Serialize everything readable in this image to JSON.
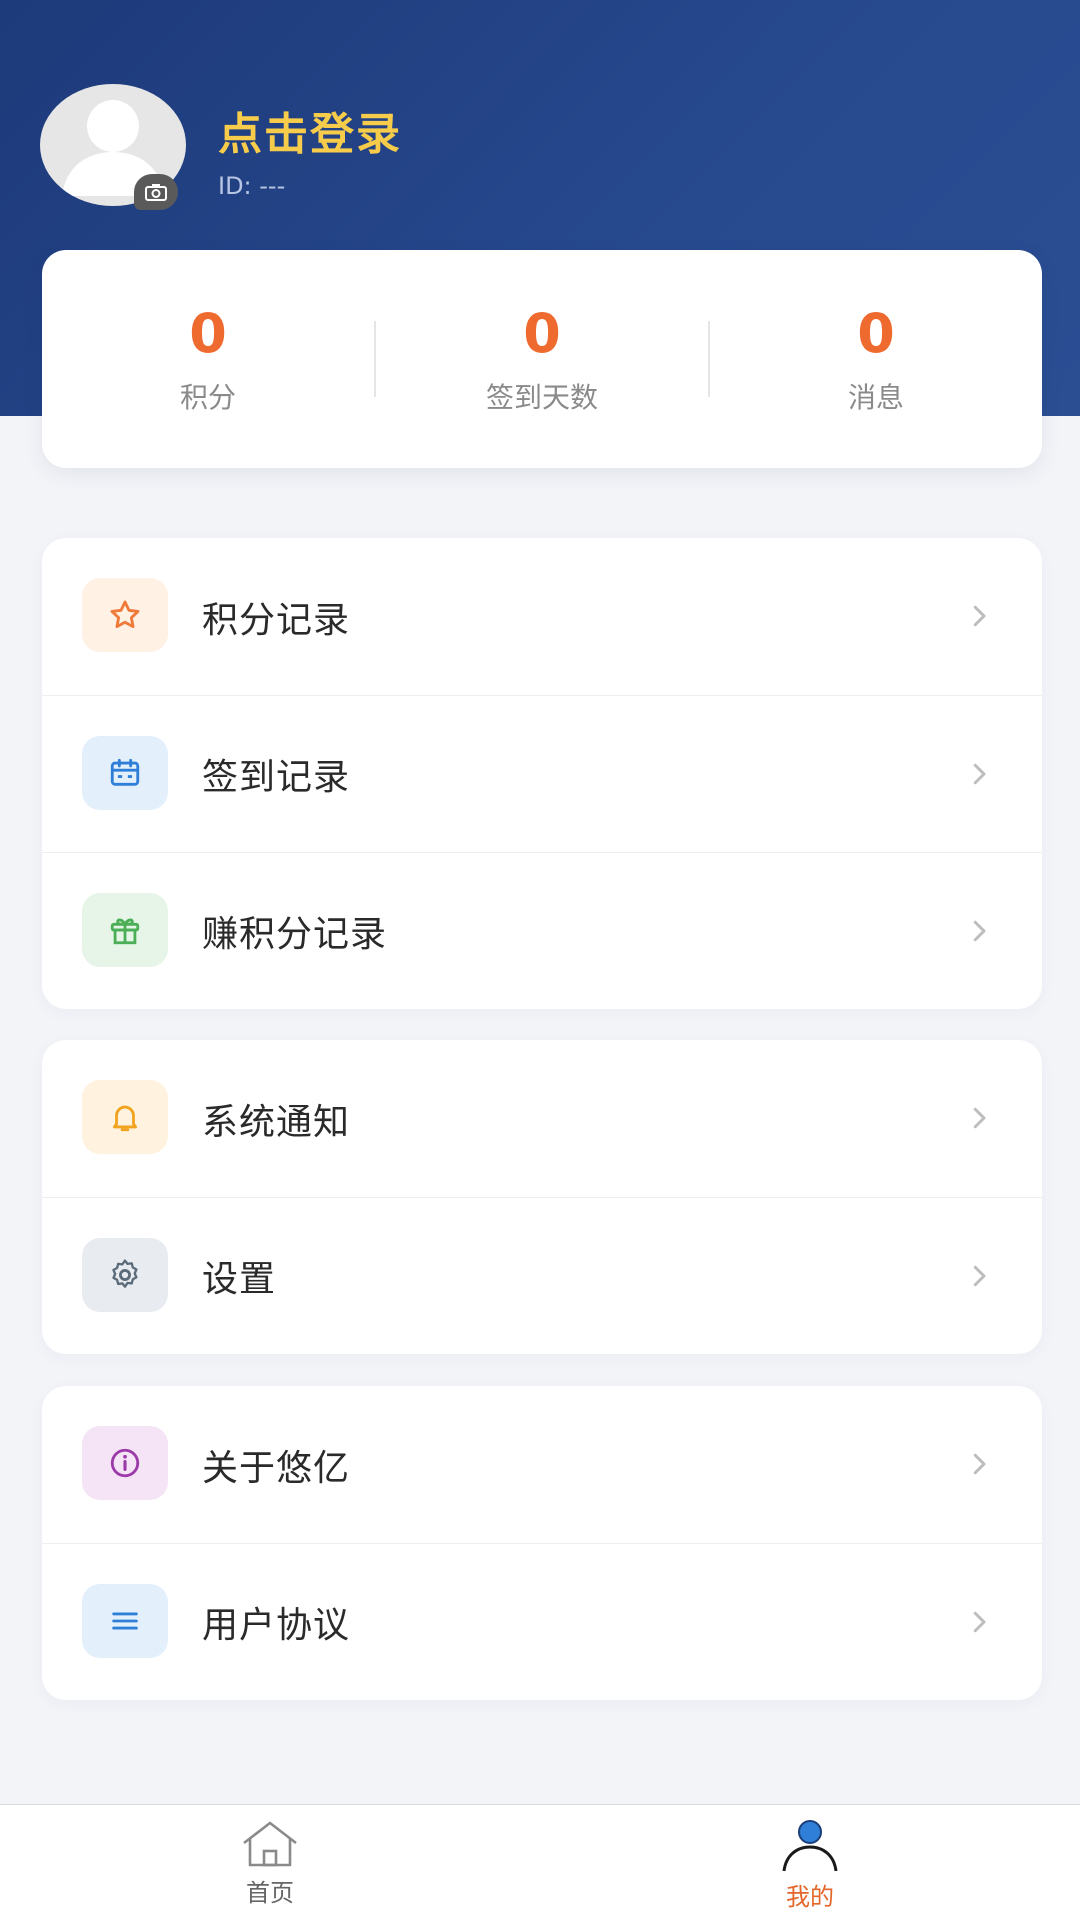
{
  "profile": {
    "login_prompt": "点击登录",
    "user_id": "ID: ---"
  },
  "stats": [
    {
      "value": "0",
      "label": "积分"
    },
    {
      "value": "0",
      "label": "签到天数"
    },
    {
      "value": "0",
      "label": "消息"
    }
  ],
  "menu_groups": [
    [
      {
        "label": "积分记录",
        "icon": "star-icon",
        "color": "#f07a3a",
        "bg": "#fff1e4"
      },
      {
        "label": "签到记录",
        "icon": "calendar-icon",
        "color": "#2f7fd8",
        "bg": "#e3f0fc"
      },
      {
        "label": "赚积分记录",
        "icon": "gift-icon",
        "color": "#4cae57",
        "bg": "#e6f5e7"
      }
    ],
    [
      {
        "label": "系统通知",
        "icon": "bell-icon",
        "color": "#f2a31e",
        "bg": "#fff2de"
      },
      {
        "label": "设置",
        "icon": "gear-icon",
        "color": "#5b6b7a",
        "bg": "#e8ebef"
      }
    ],
    [
      {
        "label": "关于悠亿",
        "icon": "info-icon",
        "color": "#9b3aa8",
        "bg": "#f4e4f6"
      },
      {
        "label": "用户协议",
        "icon": "menu-lines-icon",
        "color": "#2f7fd8",
        "bg": "#e3f0fc"
      }
    ]
  ],
  "tabbar": {
    "home": "首页",
    "mine": "我的",
    "active_color": "#e4662a"
  },
  "colors": {
    "header": "#27498e",
    "accent": "#ee6a2f",
    "login_title": "#f7cc4a"
  }
}
